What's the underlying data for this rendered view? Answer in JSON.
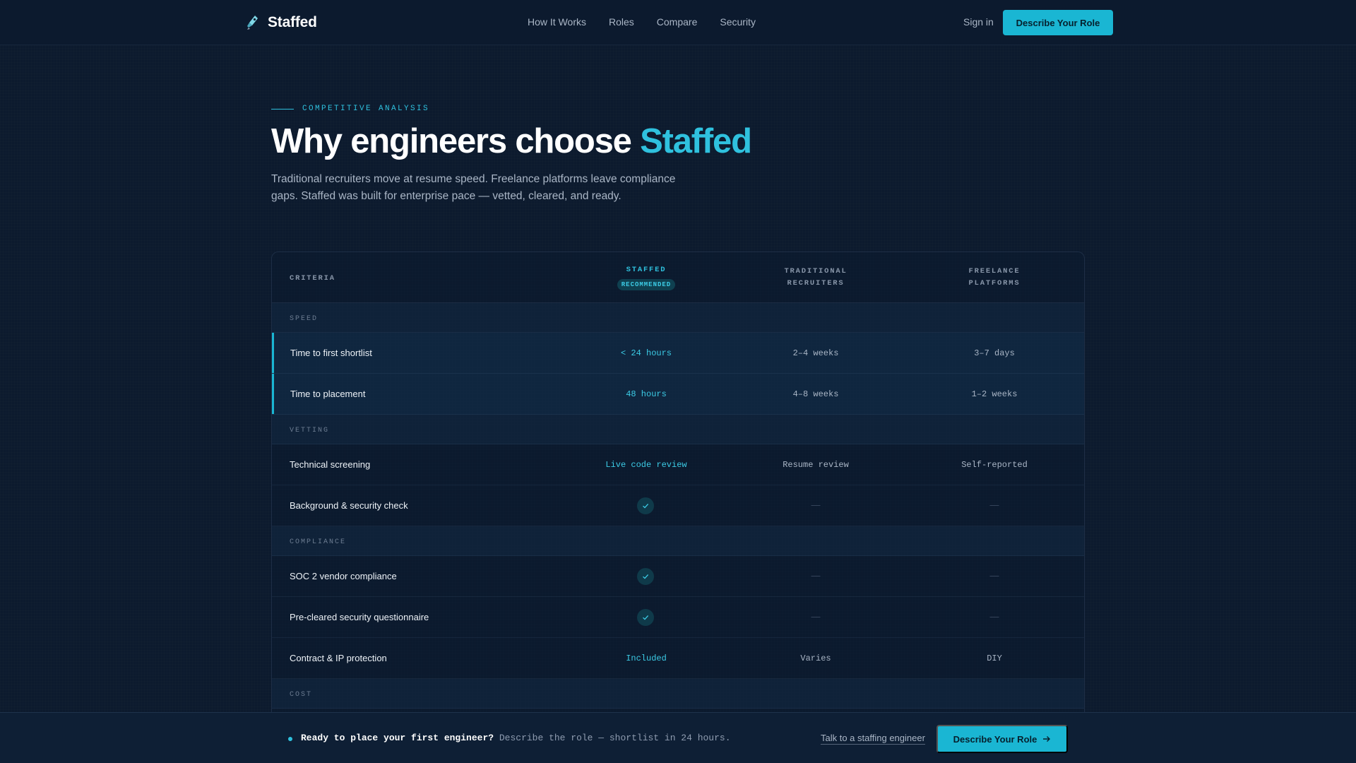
{
  "nav": {
    "brand": "Staffed",
    "logo_icon": "rocket-icon",
    "links": [
      "How It Works",
      "Roles",
      "Compare",
      "Security"
    ],
    "signin": "Sign in",
    "cta": "Describe Your Role"
  },
  "hero": {
    "eyebrow": "COMPETITIVE ANALYSIS",
    "headline_prefix": "Why engineers choose",
    "headline_accent": "Staffed",
    "subtext": "Traditional recruiters move at resume speed. Freelance platforms leave compliance gaps. Staffed was built for enterprise pace — vetted, cleared, and ready."
  },
  "table": {
    "headers": {
      "criteria": "CRITERIA",
      "staffed": "STAFFED",
      "staffed_badge": "RECOMMENDED",
      "traditional_line1": "TRADITIONAL",
      "traditional_line2": "RECRUITERS",
      "freelance_line1": "FREELANCE",
      "freelance_line2": "PLATFORMS"
    },
    "sections": [
      {
        "label": "SPEED",
        "rows": [
          {
            "label": "Time to first shortlist",
            "staffed": "< 24 hours",
            "traditional": "2–4 weeks",
            "freelance": "3–7 days"
          },
          {
            "label": "Time to placement",
            "staffed": "48 hours",
            "traditional": "4–8 weeks",
            "freelance": "1–2 weeks"
          }
        ]
      },
      {
        "label": "VETTING",
        "rows": [
          {
            "label": "Technical screening",
            "staffed": "Live code review",
            "traditional": "Resume review",
            "freelance": "Self-reported"
          },
          {
            "label": "Background & security check",
            "staffed_icon": "check-icon",
            "traditional": "—",
            "freelance": "—"
          }
        ]
      },
      {
        "label": "COMPLIANCE",
        "rows": [
          {
            "label": "SOC 2 vendor compliance",
            "staffed_icon": "check-icon",
            "traditional": "—",
            "freelance": "—"
          },
          {
            "label": "Pre-cleared security questionnaire",
            "staffed_icon": "check-icon",
            "traditional": "—",
            "freelance": "—"
          },
          {
            "label": "Contract & IP protection",
            "staffed": "Included",
            "traditional": "Varies",
            "freelance": "DIY"
          }
        ]
      },
      {
        "label": "COST",
        "rows": []
      }
    ]
  },
  "bottom_bar": {
    "strong": "Ready to place your first engineer?",
    "rest": "Describe the role — shortlist in 24 hours.",
    "link": "Talk to a staffing engineer",
    "cta": "Describe Your Role"
  },
  "colors": {
    "background": "#0c1a2e",
    "accent": "#2fc1de",
    "button": "#1ab6d3"
  }
}
